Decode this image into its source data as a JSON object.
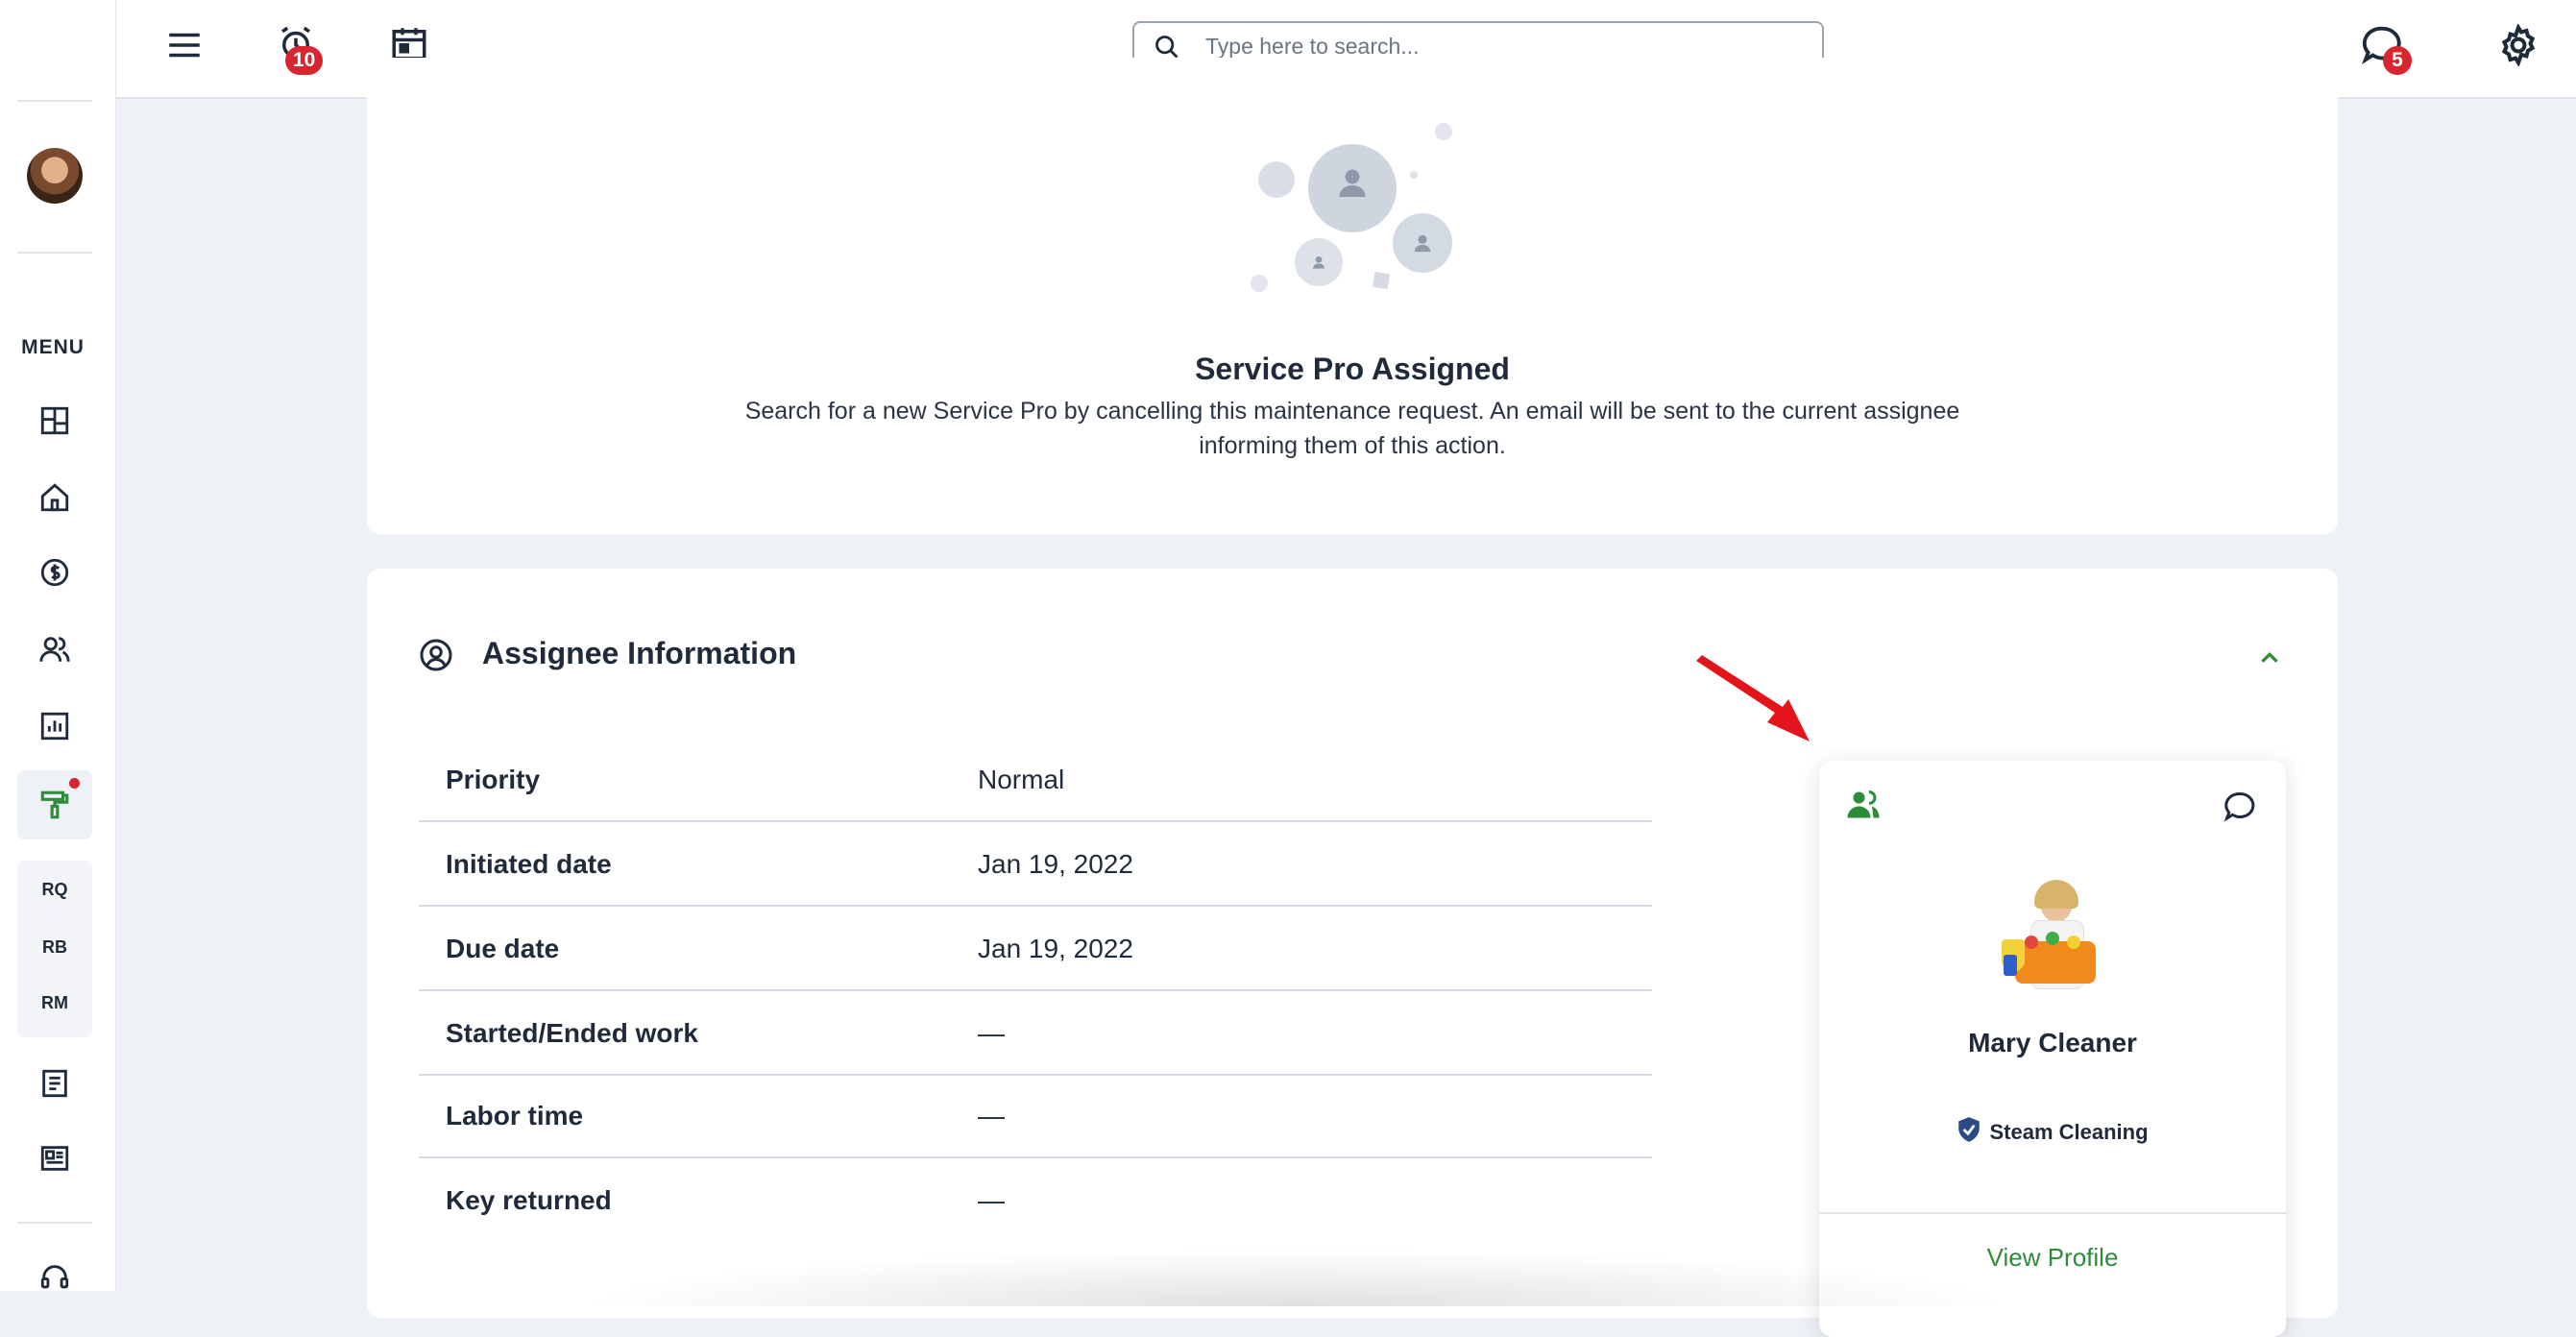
{
  "sidebar": {
    "menu_label": "MENU",
    "sub_items": [
      "RQ",
      "RB",
      "RM"
    ],
    "icons": [
      "dashboard-icon",
      "home-icon",
      "dollar-icon",
      "people-icon",
      "chart-icon",
      "maintenance-icon",
      "document-icon",
      "newspaper-icon",
      "headset-icon"
    ]
  },
  "topbar": {
    "alarm_badge": "10",
    "chat_badge": "5",
    "search_placeholder": "Type here to search..."
  },
  "assigned": {
    "title": "Service Pro Assigned",
    "description": "Search for a new Service Pro by cancelling this maintenance request. An email will be sent to the current assignee informing them of this action."
  },
  "assignee": {
    "title": "Assignee Information",
    "rows": [
      {
        "label": "Priority",
        "value": "Normal"
      },
      {
        "label": "Initiated date",
        "value": "Jan 19, 2022"
      },
      {
        "label": "Due date",
        "value": "Jan 19, 2022"
      },
      {
        "label": "Started/Ended work",
        "value": "—"
      },
      {
        "label": "Labor time",
        "value": "—"
      },
      {
        "label": "Key returned",
        "value": "—"
      }
    ]
  },
  "pro": {
    "name": "Mary Cleaner",
    "service": "Steam Cleaning",
    "view_profile": "View Profile"
  },
  "colors": {
    "accent_green": "#2e8b3a",
    "badge_red": "#d7262f",
    "arrow_red": "#e3141b"
  }
}
